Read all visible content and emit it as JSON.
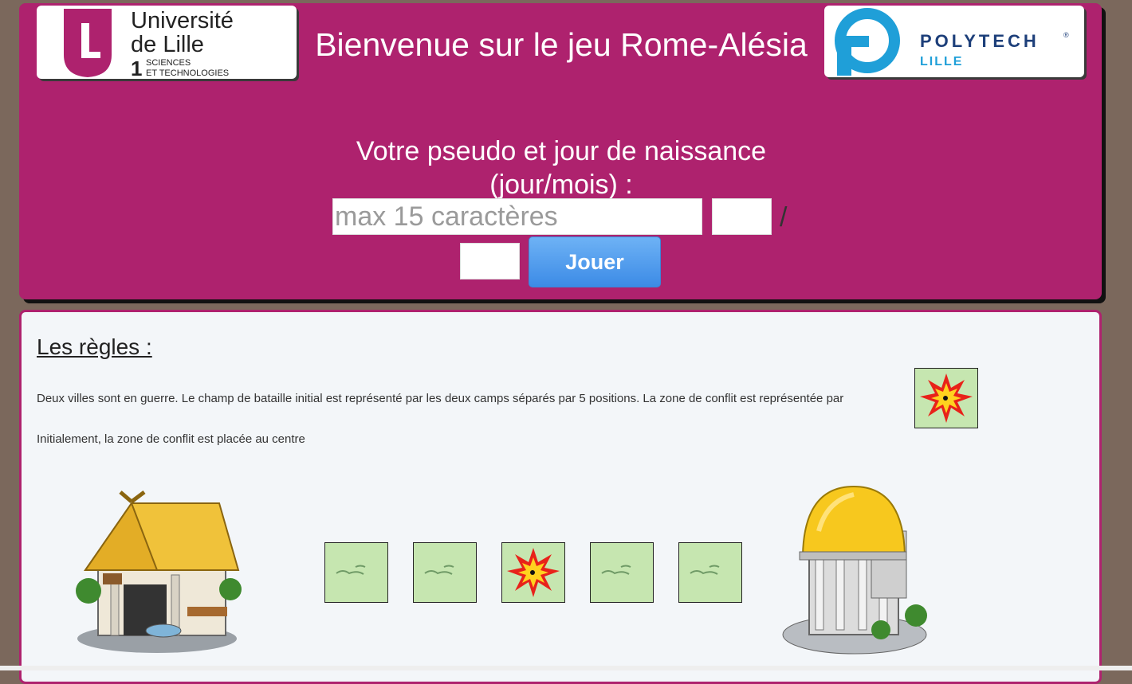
{
  "header": {
    "title": "Bienvenue sur le jeu Rome-Alésia",
    "subtitle": "Votre pseudo et jour de naissance (jour/mois) :",
    "pseudo_placeholder": "max 15 caractères",
    "date_separator": "/",
    "play_button": "Jouer"
  },
  "logos": {
    "ulille": {
      "line1": "Université",
      "line2": "de Lille",
      "number": "1",
      "line3": "SCIENCES",
      "line4": "ET TECHNOLOGIES"
    },
    "polytech": {
      "line1": "POLYTECH",
      "mark": "®",
      "line2": "LILLE"
    }
  },
  "rules": {
    "title": "Les règles :",
    "line1": "Deux villes sont en guerre. Le champ de bataille initial est représenté par les deux camps séparés par 5 positions. La zone de conflit est représentée par",
    "line2": "Initialement, la zone de conflit est placée au centre"
  },
  "battlefield": {
    "positions": [
      "grass",
      "grass",
      "conflict",
      "grass",
      "grass"
    ]
  },
  "colors": {
    "header_bg": "#ae226e",
    "page_bg": "#7b685c",
    "button": "#4a97ec",
    "tile_grass": "#c6e6b0"
  }
}
